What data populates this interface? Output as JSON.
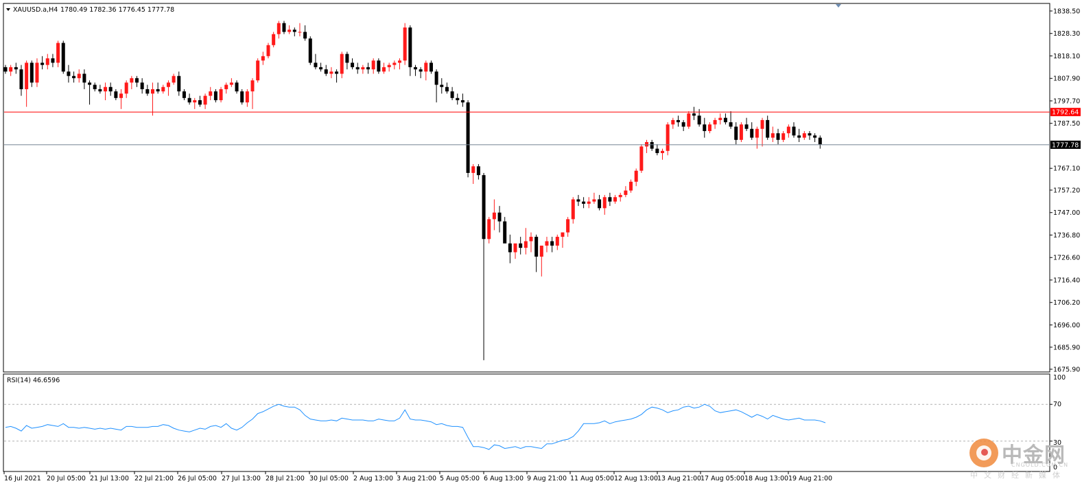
{
  "header": {
    "symbol": "XAUUSD.a,H4",
    "ohlc": "1780.49 1782.36 1776.45 1777.78"
  },
  "rsi": {
    "label": "RSI(14) 46.6596",
    "levels": [
      "100",
      "70",
      "30",
      "0"
    ],
    "color": "#1e90ff"
  },
  "watermark": {
    "name": "中金网",
    "sub": "CNGOLD.COM.CN",
    "cn": "中文财经新媒体"
  },
  "colors": {
    "up": "#ff1a1a",
    "down": "#000000",
    "hline": "#ff0000",
    "bidline": "#708090"
  },
  "chart_data": {
    "type": "candlestick",
    "y_ticks": [
      "1838.50",
      "1828.30",
      "1818.10",
      "1807.90",
      "1797.70",
      "1787.50",
      "1777.78",
      "1767.10",
      "1757.20",
      "1747.00",
      "1736.80",
      "1726.60",
      "1716.40",
      "1706.20",
      "1696.00",
      "1685.90",
      "1675.90"
    ],
    "ylim": [
      1675.9,
      1839.6
    ],
    "x_labels": [
      "16 Jul 2021",
      "20 Jul 05:00",
      "21 Jul 13:00",
      "22 Jul 21:00",
      "26 Jul 05:00",
      "27 Jul 13:00",
      "28 Jul 21:00",
      "30 Jul 05:00",
      "2 Aug 13:00",
      "3 Aug 21:00",
      "5 Aug 05:00",
      "6 Aug 13:00",
      "9 Aug 21:00",
      "11 Aug 05:00",
      "12 Aug 13:00",
      "13 Aug 21:00",
      "17 Aug 05:00",
      "18 Aug 13:00",
      "19 Aug 21:00"
    ],
    "horizontal_lines": [
      {
        "label": "1792.64",
        "value": 1792.64
      },
      {
        "label": "1777.78",
        "value": 1777.78
      }
    ],
    "rsi_levels": [
      70,
      30
    ],
    "candles": [
      [
        1813,
        1814,
        1810,
        1811
      ],
      [
        1811,
        1814,
        1809,
        1813
      ],
      [
        1813,
        1815,
        1810,
        1812
      ],
      [
        1812,
        1814,
        1800,
        1803
      ],
      [
        1803,
        1816,
        1795,
        1815
      ],
      [
        1815,
        1816,
        1804,
        1806
      ],
      [
        1806,
        1817,
        1804,
        1815
      ],
      [
        1815,
        1818,
        1812,
        1814
      ],
      [
        1814,
        1819,
        1812,
        1817
      ],
      [
        1817,
        1819,
        1813,
        1815
      ],
      [
        1815,
        1825,
        1813,
        1824
      ],
      [
        1824,
        1825,
        1810,
        1811
      ],
      [
        1811,
        1814,
        1806,
        1809
      ],
      [
        1809,
        1811,
        1806,
        1808
      ],
      [
        1808,
        1812,
        1806,
        1810
      ],
      [
        1810,
        1812,
        1803,
        1806
      ],
      [
        1806,
        1807,
        1796,
        1805
      ],
      [
        1805,
        1806,
        1802,
        1803
      ],
      [
        1803,
        1805,
        1801,
        1802
      ],
      [
        1802,
        1806,
        1798,
        1804
      ],
      [
        1804,
        1806,
        1800,
        1802
      ],
      [
        1802,
        1803,
        1798,
        1799
      ],
      [
        1799,
        1803,
        1794,
        1801
      ],
      [
        1801,
        1807,
        1799,
        1806
      ],
      [
        1806,
        1809,
        1803,
        1808
      ],
      [
        1808,
        1809,
        1804,
        1806
      ],
      [
        1806,
        1808,
        1801,
        1803
      ],
      [
        1803,
        1805,
        1800,
        1801
      ],
      [
        1801,
        1806,
        1791,
        1803
      ],
      [
        1803,
        1806,
        1801,
        1802
      ],
      [
        1802,
        1805,
        1801,
        1804
      ],
      [
        1804,
        1807,
        1800,
        1806
      ],
      [
        1806,
        1810,
        1805,
        1809
      ],
      [
        1809,
        1811,
        1800,
        1802
      ],
      [
        1802,
        1803,
        1798,
        1799
      ],
      [
        1799,
        1801,
        1796,
        1797
      ],
      [
        1797,
        1799,
        1794,
        1798
      ],
      [
        1798,
        1800,
        1795,
        1796
      ],
      [
        1796,
        1801,
        1794,
        1800
      ],
      [
        1800,
        1804,
        1798,
        1802
      ],
      [
        1802,
        1803,
        1797,
        1798
      ],
      [
        1798,
        1804,
        1797,
        1803
      ],
      [
        1803,
        1806,
        1801,
        1805
      ],
      [
        1805,
        1808,
        1804,
        1806
      ],
      [
        1806,
        1807,
        1801,
        1802
      ],
      [
        1802,
        1803,
        1796,
        1797
      ],
      [
        1797,
        1803,
        1795,
        1802
      ],
      [
        1802,
        1808,
        1794,
        1807
      ],
      [
        1807,
        1817,
        1806,
        1816
      ],
      [
        1816,
        1820,
        1814,
        1818
      ],
      [
        1818,
        1824,
        1817,
        1823
      ],
      [
        1823,
        1829,
        1822,
        1828
      ],
      [
        1828,
        1834,
        1826,
        1833
      ],
      [
        1833,
        1834,
        1828,
        1829
      ],
      [
        1829,
        1832,
        1828,
        1830
      ],
      [
        1830,
        1831,
        1827,
        1829
      ],
      [
        1829,
        1833,
        1827,
        1829
      ],
      [
        1829,
        1832,
        1825,
        1826
      ],
      [
        1826,
        1827,
        1814,
        1815
      ],
      [
        1815,
        1819,
        1812,
        1813
      ],
      [
        1813,
        1815,
        1811,
        1812
      ],
      [
        1812,
        1814,
        1809,
        1810
      ],
      [
        1810,
        1813,
        1808,
        1811
      ],
      [
        1811,
        1812,
        1806,
        1810
      ],
      [
        1810,
        1820,
        1808,
        1819
      ],
      [
        1819,
        1820,
        1812,
        1815
      ],
      [
        1815,
        1817,
        1812,
        1813
      ],
      [
        1813,
        1815,
        1810,
        1812
      ],
      [
        1812,
        1814,
        1810,
        1813
      ],
      [
        1813,
        1815,
        1810,
        1812
      ],
      [
        1812,
        1817,
        1810,
        1816
      ],
      [
        1816,
        1817,
        1810,
        1811
      ],
      [
        1811,
        1815,
        1810,
        1813
      ],
      [
        1813,
        1815,
        1811,
        1814
      ],
      [
        1814,
        1816,
        1812,
        1815
      ],
      [
        1815,
        1817,
        1812,
        1816
      ],
      [
        1816,
        1833,
        1814,
        1831
      ],
      [
        1831,
        1832,
        1809,
        1813
      ],
      [
        1813,
        1814,
        1809,
        1812
      ],
      [
        1812,
        1813,
        1808,
        1811
      ],
      [
        1811,
        1816,
        1807,
        1815
      ],
      [
        1815,
        1816,
        1810,
        1811
      ],
      [
        1811,
        1812,
        1797,
        1805
      ],
      [
        1805,
        1808,
        1801,
        1804
      ],
      [
        1804,
        1806,
        1801,
        1802
      ],
      [
        1802,
        1804,
        1798,
        1799
      ],
      [
        1799,
        1801,
        1796,
        1798
      ],
      [
        1798,
        1801,
        1795,
        1797
      ],
      [
        1797,
        1798,
        1763,
        1765
      ],
      [
        1765,
        1769,
        1760,
        1768
      ],
      [
        1768,
        1769,
        1762,
        1764
      ],
      [
        1764,
        1765,
        1680,
        1735
      ],
      [
        1735,
        1745,
        1733,
        1744
      ],
      [
        1744,
        1753,
        1739,
        1747
      ],
      [
        1747,
        1750,
        1738,
        1743
      ],
      [
        1743,
        1745,
        1734,
        1733
      ],
      [
        1733,
        1737,
        1724,
        1729
      ],
      [
        1729,
        1732,
        1726,
        1733
      ],
      [
        1733,
        1736,
        1728,
        1731
      ],
      [
        1731,
        1740,
        1728,
        1734
      ],
      [
        1734,
        1738,
        1729,
        1736
      ],
      [
        1736,
        1737,
        1720,
        1727
      ],
      [
        1727,
        1730,
        1718,
        1732
      ],
      [
        1732,
        1736,
        1729,
        1734
      ],
      [
        1734,
        1736,
        1729,
        1732
      ],
      [
        1732,
        1737,
        1730,
        1736
      ],
      [
        1736,
        1738,
        1731,
        1738
      ],
      [
        1738,
        1745,
        1736,
        1744
      ],
      [
        1744,
        1754,
        1742,
        1753
      ],
      [
        1753,
        1755,
        1750,
        1752
      ],
      [
        1752,
        1754,
        1749,
        1751
      ],
      [
        1751,
        1754,
        1749,
        1752
      ],
      [
        1752,
        1756,
        1751,
        1753
      ],
      [
        1753,
        1755,
        1748,
        1749
      ],
      [
        1749,
        1755,
        1746,
        1754
      ],
      [
        1754,
        1756,
        1750,
        1752
      ],
      [
        1752,
        1755,
        1751,
        1754
      ],
      [
        1754,
        1756,
        1752,
        1755
      ],
      [
        1755,
        1759,
        1754,
        1757
      ],
      [
        1757,
        1762,
        1756,
        1761
      ],
      [
        1761,
        1767,
        1759,
        1766
      ],
      [
        1766,
        1778,
        1765,
        1777
      ],
      [
        1777,
        1780,
        1774,
        1779
      ],
      [
        1779,
        1780,
        1775,
        1776
      ],
      [
        1776,
        1778,
        1773,
        1774
      ],
      [
        1774,
        1776,
        1771,
        1775
      ],
      [
        1775,
        1788,
        1773,
        1787
      ],
      [
        1787,
        1790,
        1785,
        1789
      ],
      [
        1789,
        1791,
        1786,
        1788
      ],
      [
        1788,
        1789,
        1784,
        1786
      ],
      [
        1786,
        1793,
        1785,
        1792
      ],
      [
        1792,
        1795,
        1789,
        1791
      ],
      [
        1791,
        1794,
        1786,
        1787
      ],
      [
        1787,
        1790,
        1781,
        1784
      ],
      [
        1784,
        1788,
        1783,
        1787
      ],
      [
        1787,
        1790,
        1785,
        1789
      ],
      [
        1789,
        1792,
        1787,
        1790
      ],
      [
        1790,
        1792,
        1787,
        1788
      ],
      [
        1788,
        1793,
        1785,
        1786
      ],
      [
        1786,
        1788,
        1778,
        1780
      ],
      [
        1780,
        1788,
        1779,
        1787
      ],
      [
        1787,
        1790,
        1784,
        1785
      ],
      [
        1785,
        1788,
        1780,
        1781
      ],
      [
        1781,
        1786,
        1776,
        1785
      ],
      [
        1785,
        1790,
        1777,
        1789
      ],
      [
        1789,
        1791,
        1780,
        1781
      ],
      [
        1781,
        1786,
        1779,
        1783
      ],
      [
        1783,
        1785,
        1778,
        1780
      ],
      [
        1780,
        1784,
        1779,
        1783
      ],
      [
        1783,
        1787,
        1781,
        1786
      ],
      [
        1786,
        1788,
        1781,
        1782
      ],
      [
        1782,
        1785,
        1779,
        1781
      ],
      [
        1781,
        1784,
        1780,
        1783
      ],
      [
        1783,
        1784,
        1780,
        1782
      ],
      [
        1782,
        1783,
        1779,
        1781
      ],
      [
        1781,
        1782,
        1776,
        1778
      ]
    ],
    "rsi_values": [
      45,
      46,
      44,
      41,
      47,
      44,
      45,
      46,
      48,
      47,
      46,
      49,
      45,
      45,
      44,
      45,
      44,
      43,
      44,
      43,
      44,
      43,
      42,
      46,
      46,
      45,
      45,
      45,
      46,
      46,
      48,
      47,
      44,
      42,
      41,
      40,
      42,
      44,
      43,
      46,
      47,
      45,
      49,
      44,
      42,
      45,
      50,
      54,
      60,
      62,
      65,
      68,
      70,
      68,
      67,
      67,
      64,
      58,
      54,
      53,
      52,
      52,
      53,
      52,
      55,
      54,
      53,
      53,
      53,
      52,
      52,
      54,
      53,
      52,
      52,
      55,
      64,
      54,
      53,
      53,
      52,
      51,
      48,
      49,
      47,
      46,
      46,
      45,
      34,
      24,
      24,
      23,
      21,
      26,
      25,
      22,
      23,
      24,
      22,
      24,
      24,
      23,
      22,
      27,
      27,
      29,
      31,
      32,
      35,
      41,
      49,
      49,
      49,
      50,
      52,
      49,
      51,
      52,
      53,
      54,
      56,
      59,
      64,
      67,
      66,
      64,
      61,
      63,
      64,
      67,
      68,
      66,
      67,
      70,
      68,
      63,
      61,
      62,
      63,
      64,
      62,
      59,
      56,
      59,
      57,
      54,
      58,
      56,
      54,
      53,
      54,
      55,
      53,
      53,
      53,
      52,
      50
    ]
  }
}
